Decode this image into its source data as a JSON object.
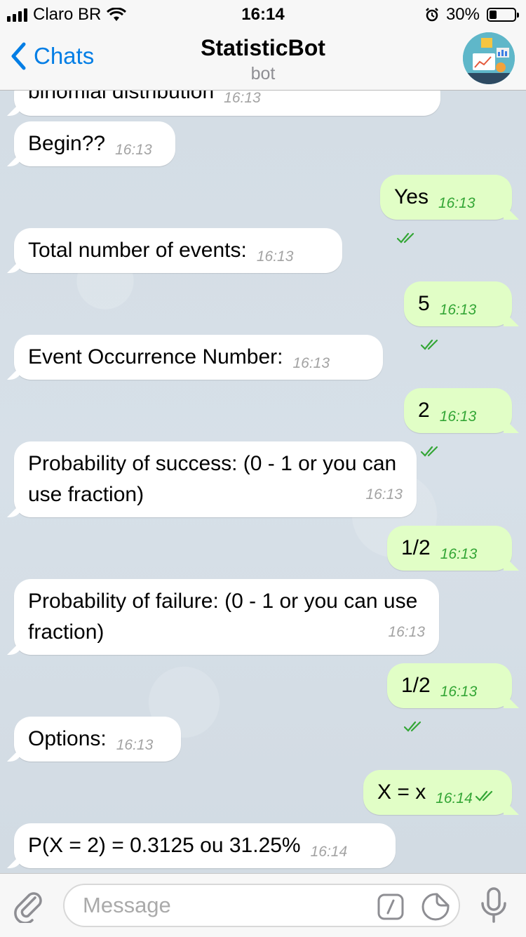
{
  "status_bar": {
    "carrier": "Claro BR",
    "time": "16:14",
    "battery": "30%",
    "battery_level": 0.3
  },
  "nav": {
    "back_label": "Chats",
    "title": "StatisticBot",
    "subtitle": "bot"
  },
  "messages": [
    {
      "dir": "in",
      "text": "binomial distribution",
      "time": "16:13"
    },
    {
      "dir": "in",
      "text": "Begin??",
      "time": "16:13"
    },
    {
      "dir": "out",
      "text": "Yes",
      "time": "16:13"
    },
    {
      "dir": "in",
      "text": "Total number of events:",
      "time": "16:13"
    },
    {
      "dir": "out",
      "text": "5",
      "time": "16:13"
    },
    {
      "dir": "in",
      "text": "Event Occurrence Number:",
      "time": "16:13"
    },
    {
      "dir": "out",
      "text": "2",
      "time": "16:13"
    },
    {
      "dir": "in",
      "text": "Probability of success: (0 - 1 or you can use fraction)",
      "time": "16:13"
    },
    {
      "dir": "out",
      "text": "1/2",
      "time": "16:13"
    },
    {
      "dir": "in",
      "text": "Probability of failure: (0 - 1 or you can use fraction)",
      "time": "16:13"
    },
    {
      "dir": "out",
      "text": "1/2",
      "time": "16:13"
    },
    {
      "dir": "in",
      "text": "Options:",
      "time": "16:13"
    },
    {
      "dir": "out",
      "text": "X = x",
      "time": "16:14"
    },
    {
      "dir": "in",
      "text": "P(X = 2) = 0.3125 ou 31.25%",
      "time": "16:14"
    }
  ],
  "input": {
    "placeholder": "Message"
  },
  "icons": {
    "back": "chevron-left-icon",
    "attach": "paperclip-icon",
    "commands": "slash-command-icon",
    "stickers": "sticker-icon",
    "mic": "microphone-icon",
    "read": "double-check-icon"
  },
  "colors": {
    "accent": "#037ee5",
    "outgoing_bubble": "#e1fec6",
    "read_tick": "#34a636"
  }
}
